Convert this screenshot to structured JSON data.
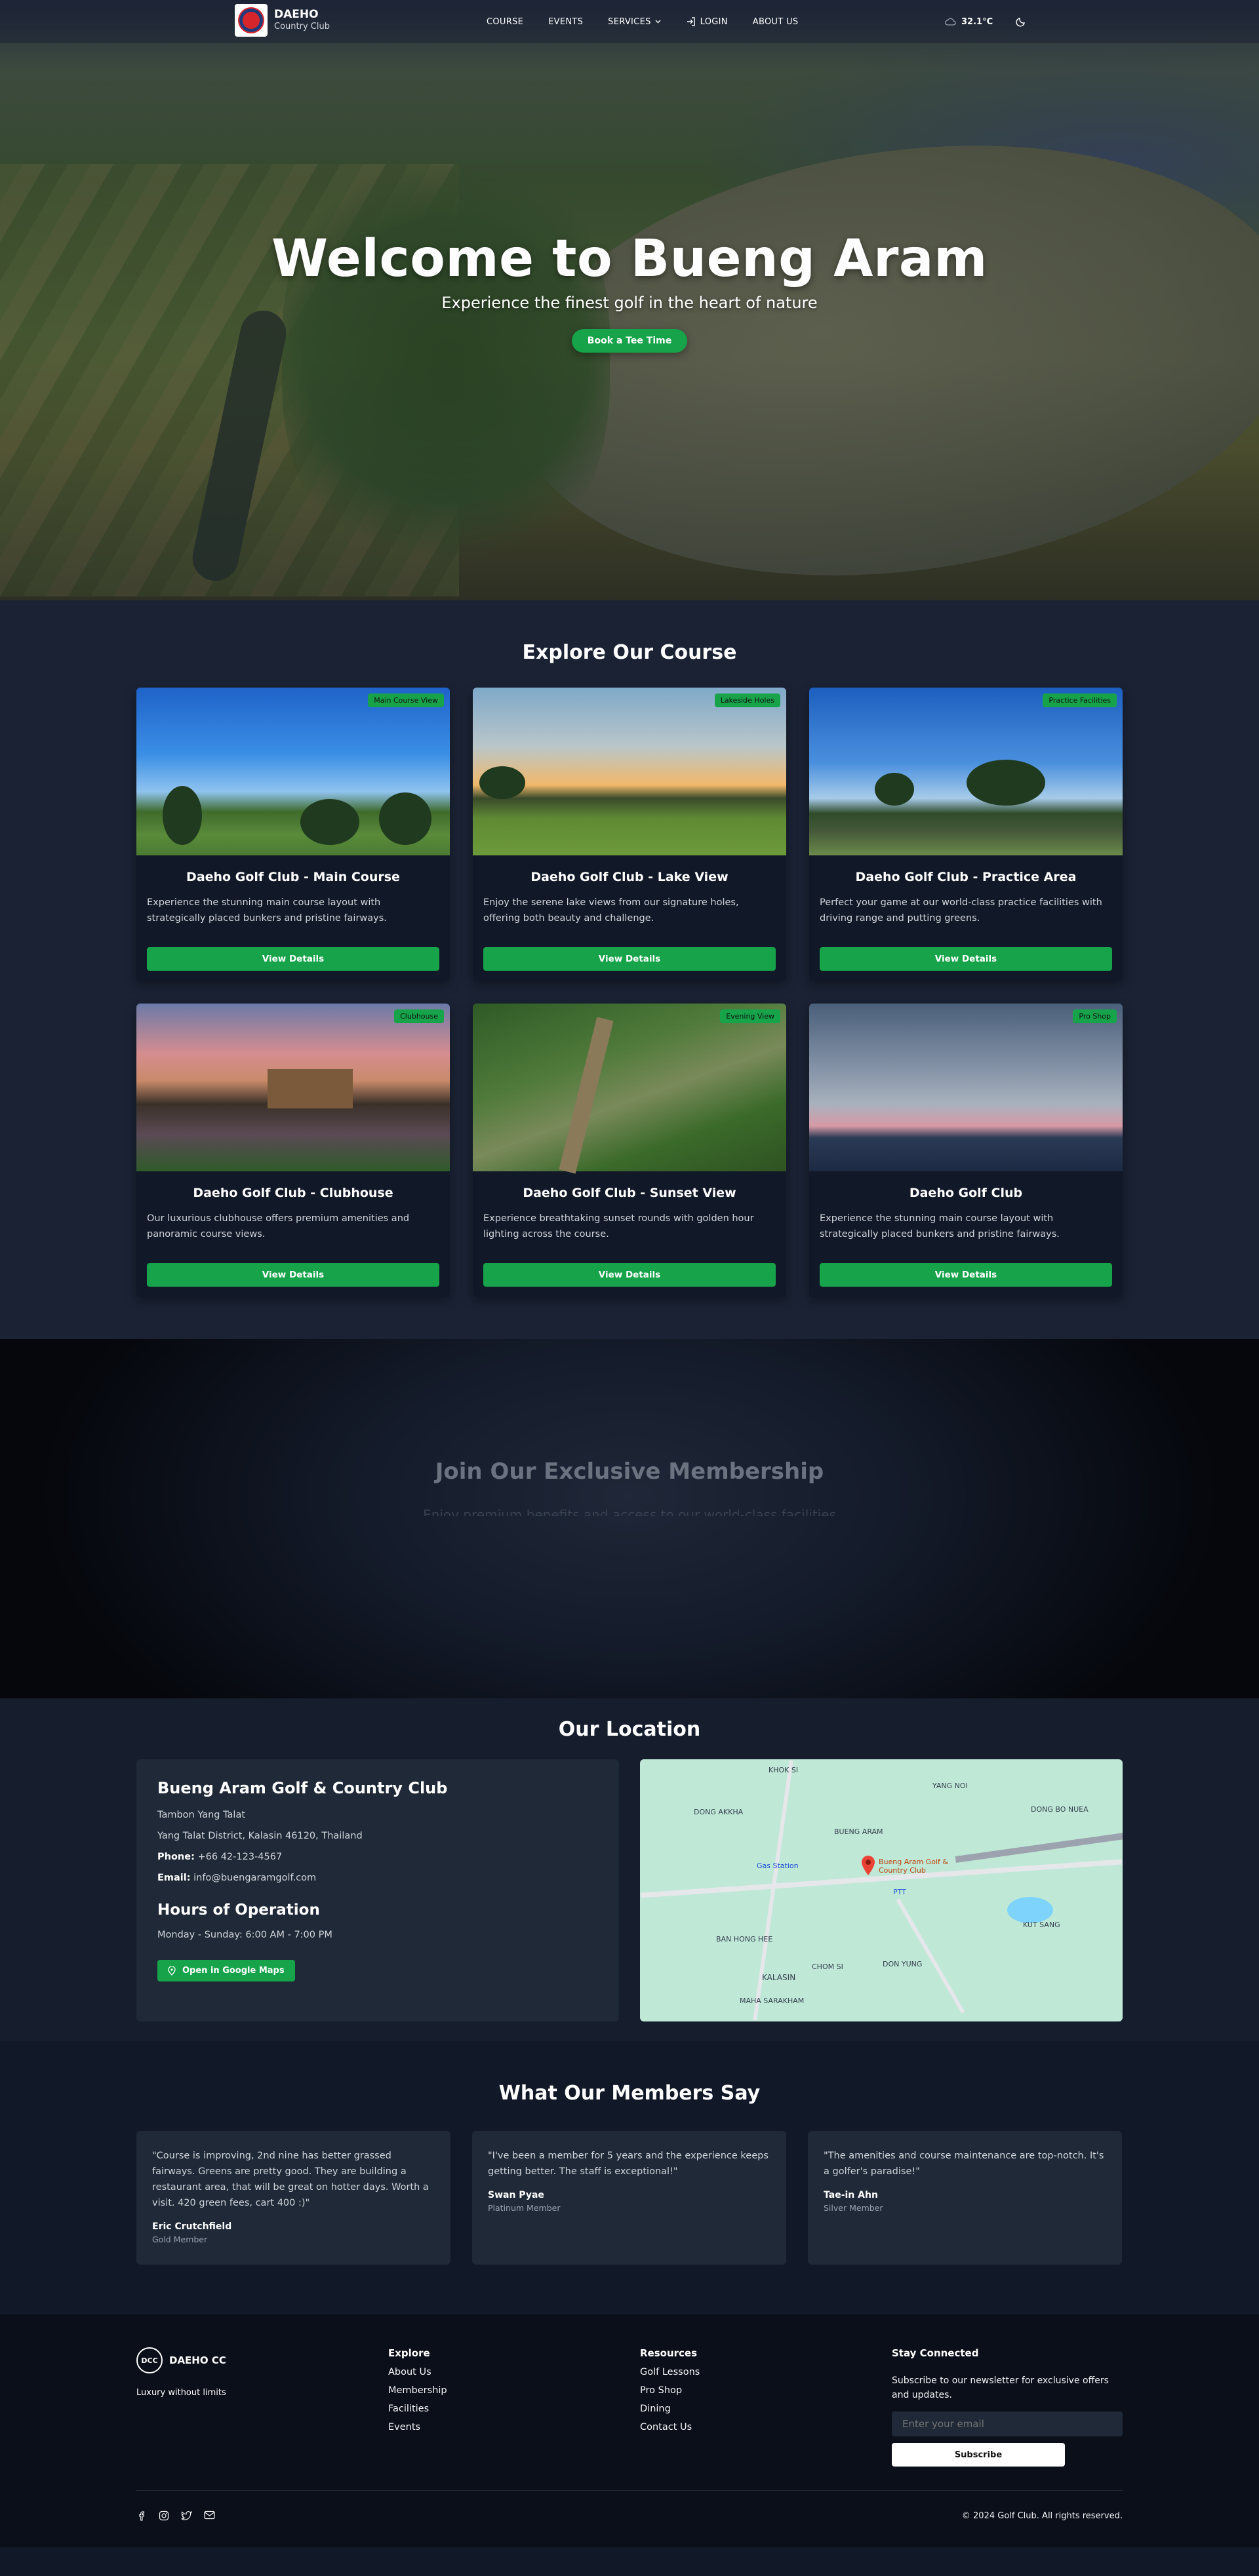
{
  "nav": {
    "brand_name": "DAEHO",
    "brand_sub": "Country Club",
    "links": [
      "COURSE",
      "EVENTS",
      "SERVICES",
      "LOGIN",
      "ABOUT US"
    ],
    "weather": "32.1°C"
  },
  "hero": {
    "title": "Welcome to Bueng Aram",
    "subtitle": "Experience the finest golf in the heart of nature",
    "cta": "Book a Tee Time"
  },
  "course": {
    "title": "Explore Our Course",
    "cards": [
      {
        "tag": "Main Course View",
        "title": "Daeho Golf Club - Main Course",
        "desc": "Experience the stunning main course layout with strategically placed bunkers and pristine fairways.",
        "button": "View Details"
      },
      {
        "tag": "Lakeside Holes",
        "title": "Daeho Golf Club - Lake View",
        "desc": "Enjoy the serene lake views from our signature holes, offering both beauty and challenge.",
        "button": "View Details"
      },
      {
        "tag": "Practice Facilities",
        "title": "Daeho Golf Club - Practice Area",
        "desc": "Perfect your game at our world-class practice facilities with driving range and putting greens.",
        "button": "View Details"
      },
      {
        "tag": "Clubhouse",
        "title": "Daeho Golf Club - Clubhouse",
        "desc": "Our luxurious clubhouse offers premium amenities and panoramic course views.",
        "button": "View Details"
      },
      {
        "tag": "Evening View",
        "title": "Daeho Golf Club - Sunset View",
        "desc": "Experience breathtaking sunset rounds with golden hour lighting across the course.",
        "button": "View Details"
      },
      {
        "tag": "Pro Shop",
        "title": "Daeho Golf Club",
        "desc": "Experience the stunning main course layout with strategically placed bunkers and pristine fairways.",
        "button": "View Details"
      }
    ]
  },
  "membership": {
    "title": "Join Our Exclusive Membership",
    "subtitle": "Enjoy premium benefits and access to our world-class facilities"
  },
  "location": {
    "title": "Our Location",
    "club_name": "Bueng Aram Golf & Country Club",
    "address1": "Tambon Yang Talat",
    "address2": "Yang Talat District, Kalasin 46120, Thailand",
    "phone_label": "Phone:",
    "phone": "+66 42-123-4567",
    "email_label": "Email:",
    "email": "info@buengaramgolf.com",
    "hours_title": "Hours of Operation",
    "hours": "Monday - Sunday: 6:00 AM - 7:00 PM",
    "map_button": "Open in Google Maps",
    "map_labels": {
      "pin": "Bueng Aram Golf & Country Club",
      "kok_si": "KHOK SI",
      "dong_akha": "DONG AKKHA",
      "yang_noi": "YANG NOI",
      "bueng_aram": "BUENG ARAM",
      "dong_bo_nuea": "DONG BO NUEA",
      "gas": "Gas Station",
      "ptt": "PTT",
      "kut_sang": "KUT SANG",
      "ban_hong_hee": "BAN HONG HEE",
      "chom_si": "CHOM SI",
      "don_yung": "DON YUNG",
      "kalasin": "KALASIN",
      "maha": "MAHA SARAKHAM"
    }
  },
  "testimonials": {
    "title": "What Our Members Say",
    "items": [
      {
        "quote": "\"Course is improving, 2nd nine has better grassed fairways. Greens are pretty good. They are building a restaurant area, that will be great on hotter days. Worth a visit. 420 green fees, cart 400 :)\"",
        "name": "Eric Crutchfield",
        "role": "Gold Member"
      },
      {
        "quote": "\"I've been a member for 5 years and the experience keeps getting better. The staff is exceptional!\"",
        "name": "Swan Pyae",
        "role": "Platinum Member"
      },
      {
        "quote": "\"The amenities and course maintenance are top-notch. It's a golfer's paradise!\"",
        "name": "Tae-in Ahn",
        "role": "Silver Member"
      }
    ]
  },
  "footer": {
    "logo_badge": "DCC",
    "logo_text": "DAEHO CC",
    "tagline": "Luxury without limits",
    "explore_title": "Explore",
    "explore": [
      "About Us",
      "Membership",
      "Facilities",
      "Events"
    ],
    "resources_title": "Resources",
    "resources": [
      "Golf Lessons",
      "Pro Shop",
      "Dining",
      "Contact Us"
    ],
    "connect_title": "Stay Connected",
    "connect_text": "Subscribe to our newsletter for exclusive offers and updates.",
    "email_placeholder": "Enter your email",
    "subscribe": "Subscribe",
    "copyright": "© 2024 Golf Club. All rights reserved."
  },
  "colors": {
    "accent": "#16a34a",
    "bg": "#111827",
    "card": "#1f2937"
  }
}
